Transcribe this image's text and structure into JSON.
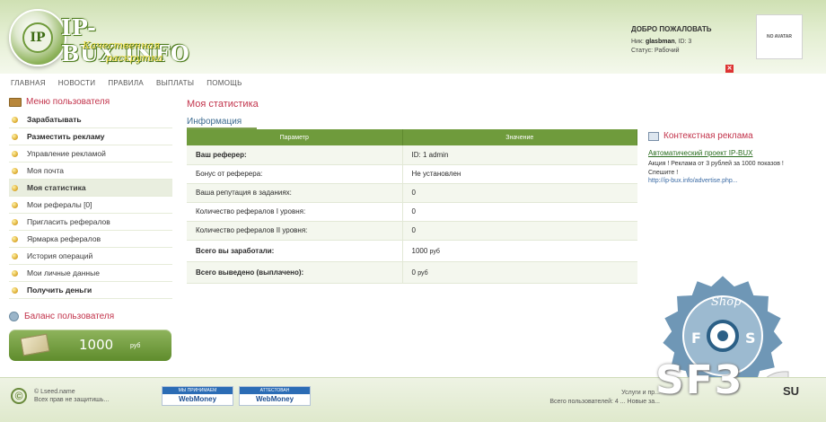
{
  "brand": {
    "logo_mark": "IP",
    "title": "IP-BUX.INFO",
    "tagline_1": "Качественная",
    "tagline_2": "раскрутка"
  },
  "welcome": {
    "title": "ДОБРО ПОЖАЛОВАТЬ",
    "nick_label": "Ник:",
    "nick_value": "glasbman",
    "id_label": "ID:",
    "id_value": "3",
    "status_label": "Статус:",
    "status_value": "Рабочий",
    "avatar_text": "NO AVATAR",
    "close_glyph": "✕"
  },
  "nav": [
    {
      "label": "ГЛАВНАЯ"
    },
    {
      "label": "НОВОСТИ"
    },
    {
      "label": "ПРАВИЛА"
    },
    {
      "label": "ВЫПЛАТЫ"
    },
    {
      "label": "ПОМОЩЬ"
    }
  ],
  "sidebar": {
    "title": "Меню пользователя",
    "items": [
      {
        "label": "Зарабатывать"
      },
      {
        "label": "Разместить рекламу"
      },
      {
        "label": "Управление рекламой"
      },
      {
        "label": "Моя почта"
      },
      {
        "label": "Моя статистика"
      },
      {
        "label": "Мои рефералы [0]"
      },
      {
        "label": "Пригласить рефералов"
      },
      {
        "label": "Ярмарка рефералов"
      },
      {
        "label": "История операций"
      },
      {
        "label": "Мои личные данные"
      },
      {
        "label": "Получить деньги"
      }
    ],
    "balance_title": "Баланс пользователя",
    "balance_value": "1000",
    "balance_unit": "руб"
  },
  "main": {
    "page_title": "Моя статистика",
    "section_title": "Информация",
    "columns": [
      "Параметр",
      "Значение"
    ],
    "rows": [
      {
        "label": "Ваш реферер:",
        "value": "ID: 1 admin"
      },
      {
        "label": "Бонус от реферера:",
        "value": "Не установлен"
      },
      {
        "label": "Ваша репутация в заданиях:",
        "value": "0"
      },
      {
        "label": "Количество рефералов I уровня:",
        "value": "0"
      },
      {
        "label": "Количество рефералов II уровня:",
        "value": "0"
      },
      {
        "label": "Всего вы заработали:",
        "value": "1000",
        "unit": "руб"
      },
      {
        "label": "Всего выведено (выплачено):",
        "value": "0",
        "unit": "руб"
      }
    ]
  },
  "ad": {
    "title": "Контекстная реклама",
    "link": "Автоматический проект IP-BUX",
    "text": "Акция ! Реклама от 3 рублей за 1000 показов ! Спешите !",
    "url": "http://ip-bux.info/advertise.php..."
  },
  "badge": {
    "text_top": "Shop",
    "text_left": "F",
    "text_right": "S"
  },
  "footer": {
    "copyright_name": "© Lseed.name",
    "copyright_sub": "Всех прав не защитишь...",
    "wm1_top": "МЫ ПРИНИМАЕМ",
    "wm1_bottom": "WebMoney",
    "wm2_top": "АТТЕСТОВАН",
    "wm2_bottom": "WebMoney",
    "right_line1": "Услуги и пр...",
    "right_line2": "Всего пользователей: 4 ... Новые за..."
  },
  "watermark": {
    "main": "SF3",
    "suffix": "SU"
  },
  "colors": {
    "accent_green": "#6f9b3c",
    "heading_red": "#c2334b",
    "link_green": "#2a6d1f"
  }
}
